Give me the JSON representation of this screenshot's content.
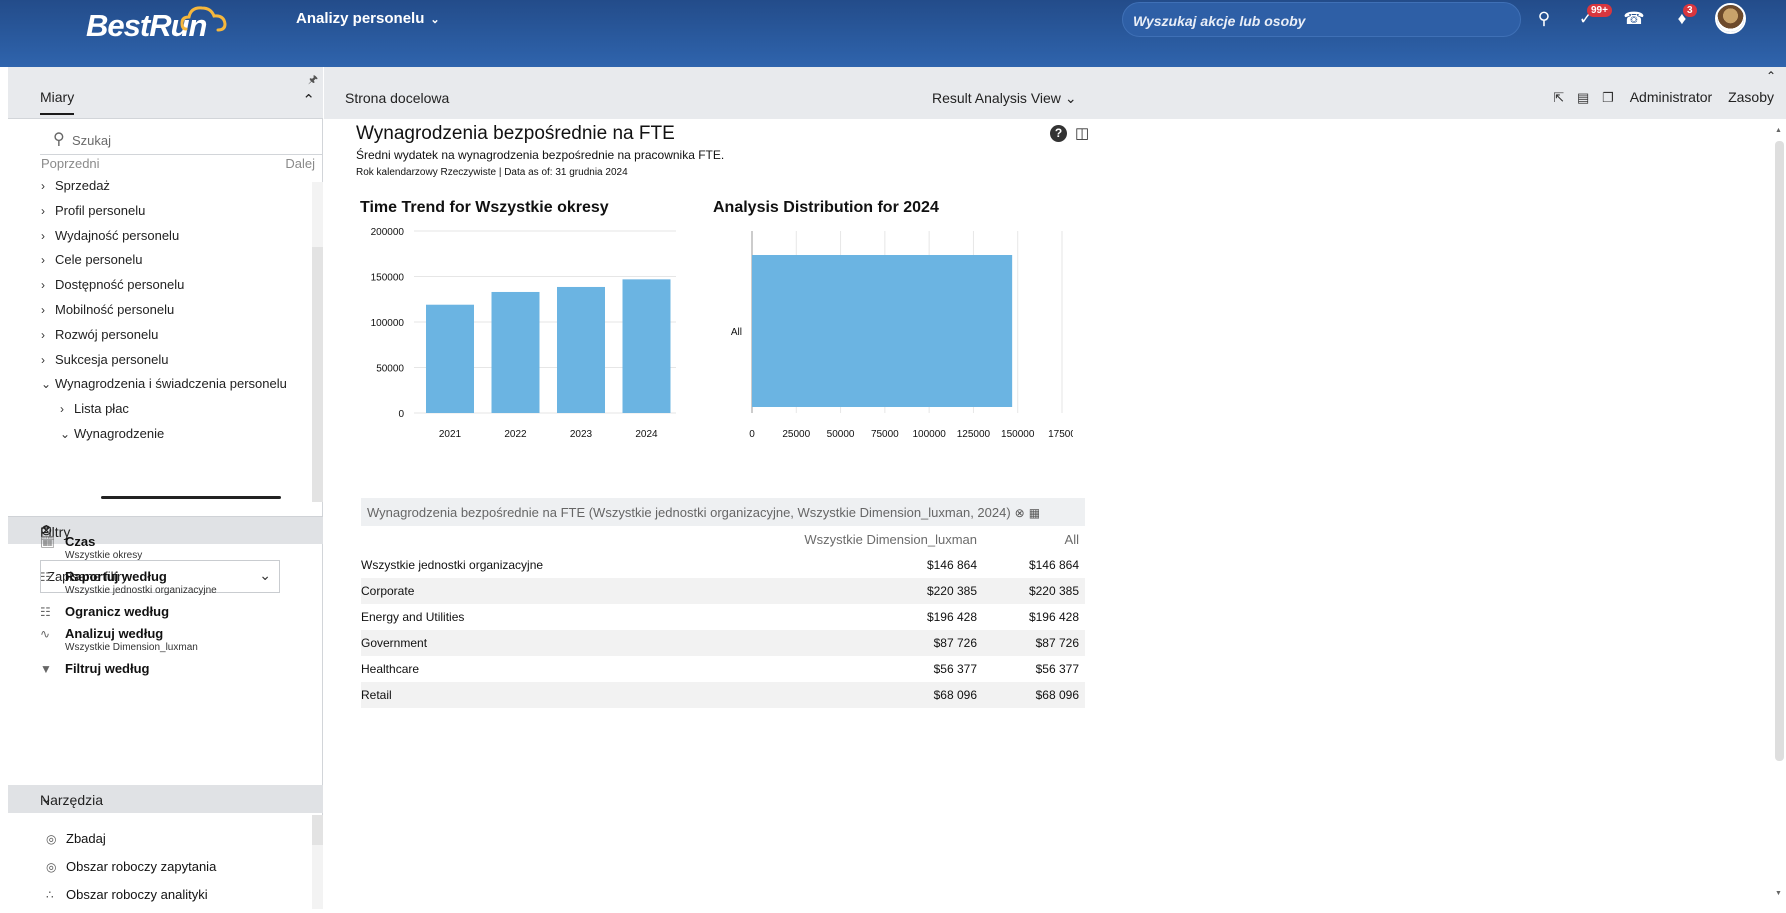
{
  "header": {
    "logo_text": "BestRun",
    "module": "Analizy personelu",
    "search_placeholder": "Wyszukaj akcje lub osoby",
    "todo_badge": "99+",
    "notifications_badge": "3"
  },
  "left_panel": {
    "measures_tab": "Miary",
    "search_placeholder": "Szukaj",
    "prev": "Poprzedni",
    "next": "Dalej",
    "measure_items": [
      {
        "label": "Sprzedaż",
        "expanded": false
      },
      {
        "label": "Profil personelu",
        "expanded": false
      },
      {
        "label": "Wydajność personelu",
        "expanded": false
      },
      {
        "label": "Cele personelu",
        "expanded": false
      },
      {
        "label": "Dostępność personelu",
        "expanded": false
      },
      {
        "label": "Mobilność personelu",
        "expanded": false
      },
      {
        "label": "Rozwój personelu",
        "expanded": false
      },
      {
        "label": "Sukcesja personelu",
        "expanded": false
      },
      {
        "label": "Wynagrodzenia i świadczenia personelu",
        "expanded": true
      },
      {
        "label": "Lista płac",
        "expanded": false
      },
      {
        "label": "Wynagrodzenie",
        "expanded": true
      }
    ],
    "filters_title": "Filtry",
    "saved_filters": "Zapisane filtry",
    "filters": [
      {
        "title": "Czas",
        "sub": "Wszystkie okresy",
        "icon": "calendar-icon"
      },
      {
        "title": "Raportuj według",
        "sub": "Wszystkie jednostki organizacyjne",
        "icon": "org-chart-icon"
      },
      {
        "title": "Ogranicz według",
        "sub": "",
        "icon": "org-chart-icon"
      },
      {
        "title": "Analizuj według",
        "sub": "Wszystkie Dimension_luxman",
        "icon": "trend-icon"
      },
      {
        "title": "Filtruj według",
        "sub": "",
        "icon": "funnel-icon"
      }
    ],
    "tools_title": "Narzędzia",
    "tools": [
      "Zbadaj",
      "Obszar roboczy zapytania",
      "Obszar roboczy analityki"
    ]
  },
  "content_bar": {
    "breadcrumb": "Strona docelowa",
    "view": "Result Analysis View",
    "admin": "Administrator",
    "resources": "Zasoby"
  },
  "main": {
    "title": "Wynagrodzenia bezpośrednie na FTE",
    "subtitle": "Średni wydatek na wynagrodzenia bezpośrednie na pracownika FTE.",
    "meta": "Rok kalendarzowy Rzeczywiste | Data as of: 31 grudnia 2024",
    "chart1_title": "Time Trend for Wszystkie okresy",
    "chart2_title": "Analysis Distribution for 2024",
    "table_caption": "Wynagrodzenia bezpośrednie na FTE (Wszystkie jednostki organizacyjne, Wszystkie Dimension_luxman, 2024)",
    "table_columns": [
      "Wszystkie Dimension_luxman",
      "All"
    ],
    "table_rows": [
      {
        "name": "Wszystkie jednostki organizacyjne",
        "v1": "$146 864",
        "v2": "$146 864"
      },
      {
        "name": "Corporate",
        "v1": "$220 385",
        "v2": "$220 385"
      },
      {
        "name": "Energy and Utilities",
        "v1": "$196 428",
        "v2": "$196 428"
      },
      {
        "name": "Government",
        "v1": "$87 726",
        "v2": "$87 726"
      },
      {
        "name": "Healthcare",
        "v1": "$56 377",
        "v2": "$56 377"
      },
      {
        "name": "Retail",
        "v1": "$68 096",
        "v2": "$68 096"
      }
    ]
  },
  "colors": {
    "bar": "#6bb4e2",
    "header_top": "#234c8a",
    "header_bottom": "#2f64ad"
  },
  "chart_data": [
    {
      "type": "bar",
      "title": "Time Trend for Wszystkie okresy",
      "categories": [
        "2021",
        "2022",
        "2023",
        "2024"
      ],
      "values": [
        119000,
        133000,
        138500,
        146864
      ],
      "ylim": [
        0,
        200000
      ],
      "yticks": [
        "0",
        "50000",
        "100000",
        "150000",
        "200000"
      ]
    },
    {
      "type": "bar",
      "orientation": "horizontal",
      "title": "Analysis Distribution for 2024",
      "categories": [
        "All"
      ],
      "values": [
        146864
      ],
      "xlim": [
        0,
        175000
      ],
      "xticks": [
        "0",
        "25000",
        "50000",
        "75000",
        "100000",
        "125000",
        "150000",
        "17500"
      ]
    }
  ]
}
